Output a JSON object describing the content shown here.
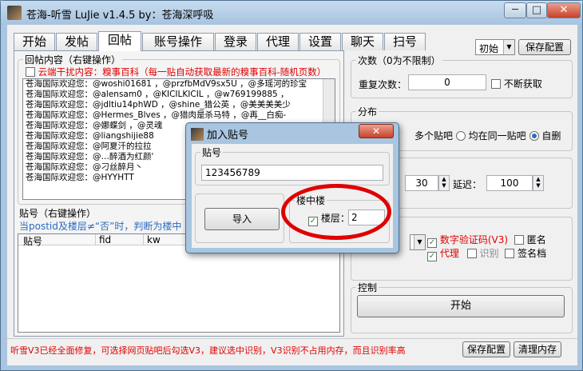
{
  "window": {
    "title": "苍海-听雪  LuJie  v1.4.5  by：苍海深呼吸",
    "min_glyph": "─",
    "max_glyph": "□",
    "close_glyph": "✕"
  },
  "tabs": [
    "开始",
    "发帖",
    "回帖",
    "账号操作",
    "登录",
    "代理",
    "设置",
    "聊天",
    "扫号"
  ],
  "active_tab": "回帖",
  "top_right": {
    "combo_value": "初始",
    "save_config": "保存配置"
  },
  "reply_panel": {
    "legend": "回帖内容（右键操作）",
    "cloud_checkbox_label": "云端干扰内容：糗事百科（每一贴自动获取最新的糗事百科-随机页数）",
    "lines": [
      "苍海国际欢迎您：@woshi01681   ，@przfbMdV9sx5U   ，@多瑶河的珍宝",
      "苍海国际欢迎您：@alensam0    ，@KICILKICIL    ，@w769199885   ，",
      "苍海国际欢迎您：@jdltiu14phWD   ，@shine_猎公英   ，@美美美美少",
      "苍海国际欢迎您：@Hermes_Blves   ，@猎肉是杀马特   ，@再__白痴-",
      "苍海国际欢迎您：@娜蝶剑       ，@灵魂",
      "苍海国际欢迎您：@liangshijie88",
      "苍海国际欢迎您：@阿夏汗的拉拉",
      "苍海国际欢迎您：@…醉酒为红颜'",
      "苍海国际欢迎您：@刁丝醉月丶",
      "苍海国际欢迎您：@HYYHTT"
    ]
  },
  "post_panel": {
    "legend": "贴号（右键操作）",
    "hint": "当postid及楼层≠“否”时，判断为楼中",
    "columns": [
      "贴号",
      "fid",
      "kw"
    ]
  },
  "count_group": {
    "legend": "次数（0为不限制）",
    "repeat_label": "重复次数：",
    "repeat_value": "0",
    "no_stop_label": "不断获取"
  },
  "dist_group": {
    "legend": "分布",
    "opt_multi": "多个贴吧",
    "opt_same": "均在同一贴吧",
    "opt_auto": "自删"
  },
  "thread_group": {
    "value_a": "30",
    "delay_label": "延迟：",
    "delay_value": "100"
  },
  "options_group": {
    "captcha_label": "数字验证码(V3)",
    "anonymous_label": "匿名",
    "proxy_label": "代理",
    "recognize_label": "识别",
    "signature_label": "签名档"
  },
  "control_group": {
    "legend": "控制",
    "start_button": "开始"
  },
  "status": {
    "message": "听雪V3已经全面修复，可选择网页贴吧后勾选V3，建议选中识别，V3识别不占用内存，而且识别率高",
    "save_config": "保存配置",
    "clear_memory": "清理内存"
  },
  "dialog": {
    "title": "加入贴号",
    "close_glyph": "✕",
    "post_id_legend": "贴号",
    "post_id_value": "123456789",
    "import_button": "导入",
    "floor_legend": "楼中楼",
    "floor_label": "楼层：",
    "floor_value": "2"
  },
  "colors": {
    "accent_red": "#e00000",
    "title_bar": "#a9c5e0"
  }
}
